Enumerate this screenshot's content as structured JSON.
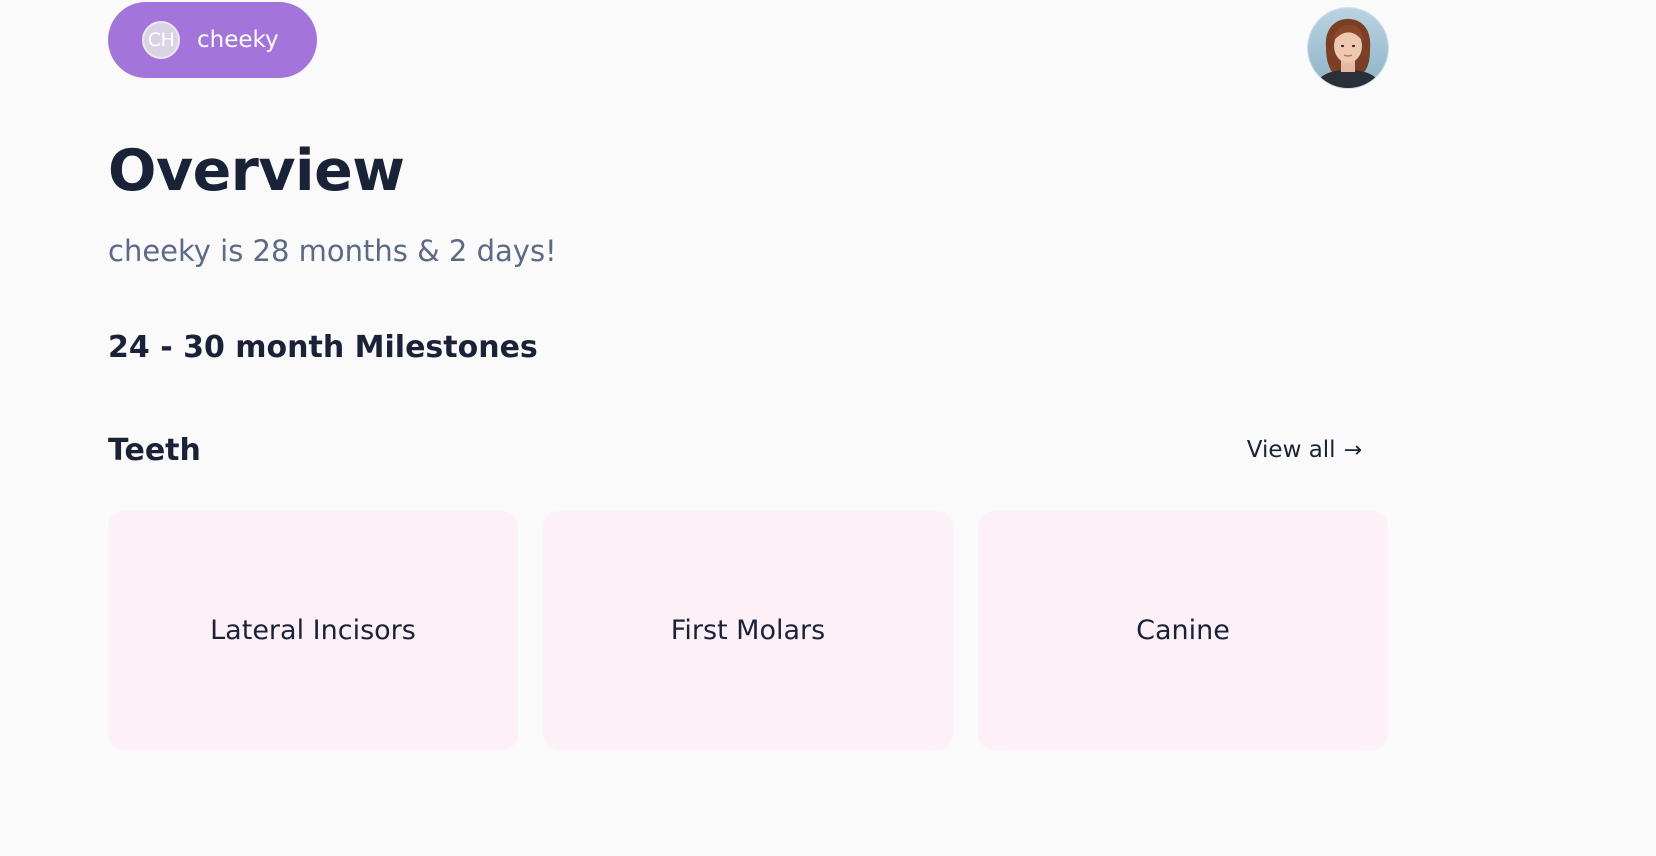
{
  "header": {
    "child": {
      "initials": "CH",
      "name": "cheeky",
      "pill_color": "#a374d9"
    },
    "user_avatar": {
      "icon": "user-avatar-photo"
    }
  },
  "overview": {
    "title": "Overview",
    "age_text": "cheeky is 28 months & 2 days!",
    "milestones_heading": "24 - 30 month Milestones"
  },
  "teeth": {
    "title": "Teeth",
    "view_all_label": "View all",
    "view_all_arrow": "→",
    "cards": [
      {
        "label": "Lateral Incisors"
      },
      {
        "label": "First Molars"
      },
      {
        "label": "Canine"
      }
    ],
    "card_color": "#fdf1f7"
  },
  "colors": {
    "background": "#fafafa",
    "text_primary": "#1a2238",
    "text_secondary": "#5c6a87",
    "accent": "#a374d9"
  }
}
